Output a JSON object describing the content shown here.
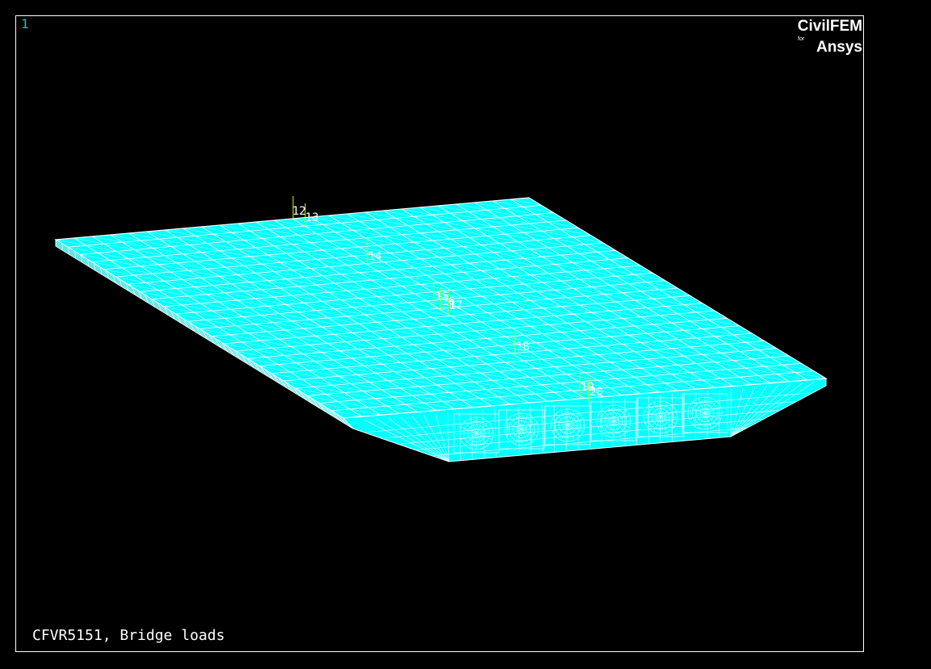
{
  "window": {
    "number": "1",
    "caption": "CFVR5151, Bridge loads"
  },
  "logo": {
    "main": "CivilFEM",
    "for": "for",
    "sub": "Ansys"
  },
  "load_labels": [
    "12",
    "13",
    "14",
    "15",
    "16",
    "17",
    "18",
    "19",
    "20"
  ],
  "colors": {
    "background": "#000000",
    "mesh_fill": "#00ffff",
    "mesh_face": "#00dddd",
    "mesh_lines": "#ffffff",
    "load_arrows": "#c8ff00",
    "window_number": "#00c8c8"
  }
}
